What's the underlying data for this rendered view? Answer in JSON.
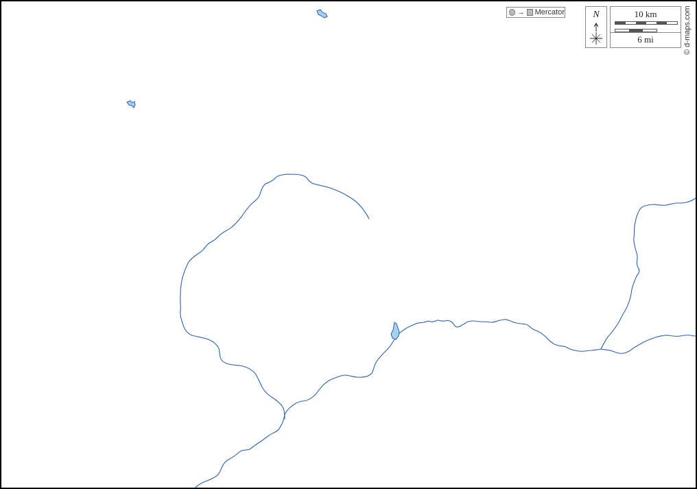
{
  "map": {
    "projection_label": "Mercator",
    "north_label": "N",
    "scale": {
      "km_label": "10 km",
      "mi_label": "6 mi"
    },
    "credit": "© d-maps.com",
    "colors": {
      "water_line": "#2a5fb0",
      "lake_fill": "#a8d0f0",
      "border": "#000000",
      "background": "#ffffff"
    },
    "icons": [
      "projection-circle-icon",
      "projection-square-icon",
      "north-arrow-icon",
      "compass-rose-icon"
    ]
  }
}
